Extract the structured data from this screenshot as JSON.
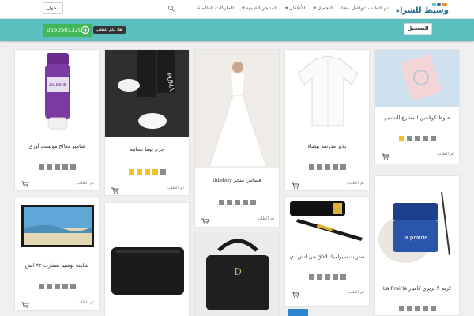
{
  "header": {
    "logo_text": "وسيط للشراء",
    "nav": [
      {
        "label": "الماركات العالمية",
        "dropdown": false
      },
      {
        "label": "المتاجر الصينيه",
        "dropdown": true
      },
      {
        "label": "الأطفال",
        "dropdown": true
      },
      {
        "label": "التجميل",
        "dropdown": true
      },
      {
        "label": "تم الطلب :تواصل معنا",
        "dropdown": false
      }
    ],
    "login_label": "دخول",
    "icons": {
      "search": "search-icon"
    }
  },
  "band": {
    "register_label": "التسجيل",
    "phone": "0550501320",
    "whatsapp_label": "أهلا بكم للطلب",
    "colors": {
      "band": "#5bbfc0",
      "whatsapp": "#43b55a"
    }
  },
  "colors": {
    "star_on": "#f3c125",
    "star_off": "#8b8b8b"
  },
  "cards": [
    {
      "title": "شامبو معالج مويست أوزي",
      "stars": 0,
      "order_label": "تم الطلب",
      "image": "shampoo-bottle"
    },
    {
      "title": "جزم بوما نسائيه",
      "stars": 4,
      "order_label": "تم الطلب",
      "image": "sneakers"
    },
    {
      "title": "فساتين متجر tidebuy",
      "stars": 0,
      "order_label": "تم الطلب",
      "image": "wedding-dress"
    },
    {
      "title": "بلايز مدرسة بيضاء",
      "stars": 0,
      "order_label": "تم الطلب",
      "image": "white-shirt"
    },
    {
      "title": "خيوط كولاجين المشرع للتشنيم",
      "stars": 1,
      "order_label": "تم الطلب",
      "image": "collagen-pack"
    },
    {
      "title": "شاشة توشيبا سمارت ٣٢ انش",
      "stars": 0,
      "order_label": "تم الطلب",
      "image": "tv"
    },
    {
      "title": "",
      "stars": 0,
      "order_label": "",
      "image": "laptop-sleeve"
    },
    {
      "title": "",
      "stars": 0,
      "order_label": "",
      "image": "handbag"
    },
    {
      "title": "ستريت سيراميك ghd جي اتش دي",
      "stars": 0,
      "order_label": "تم الطلب",
      "image": "hair-straightener"
    },
    {
      "title": "كريم لا بريري كافيار La Prairie",
      "stars": 0,
      "order_label": "تم الطلب",
      "image": "cream-jar"
    }
  ]
}
